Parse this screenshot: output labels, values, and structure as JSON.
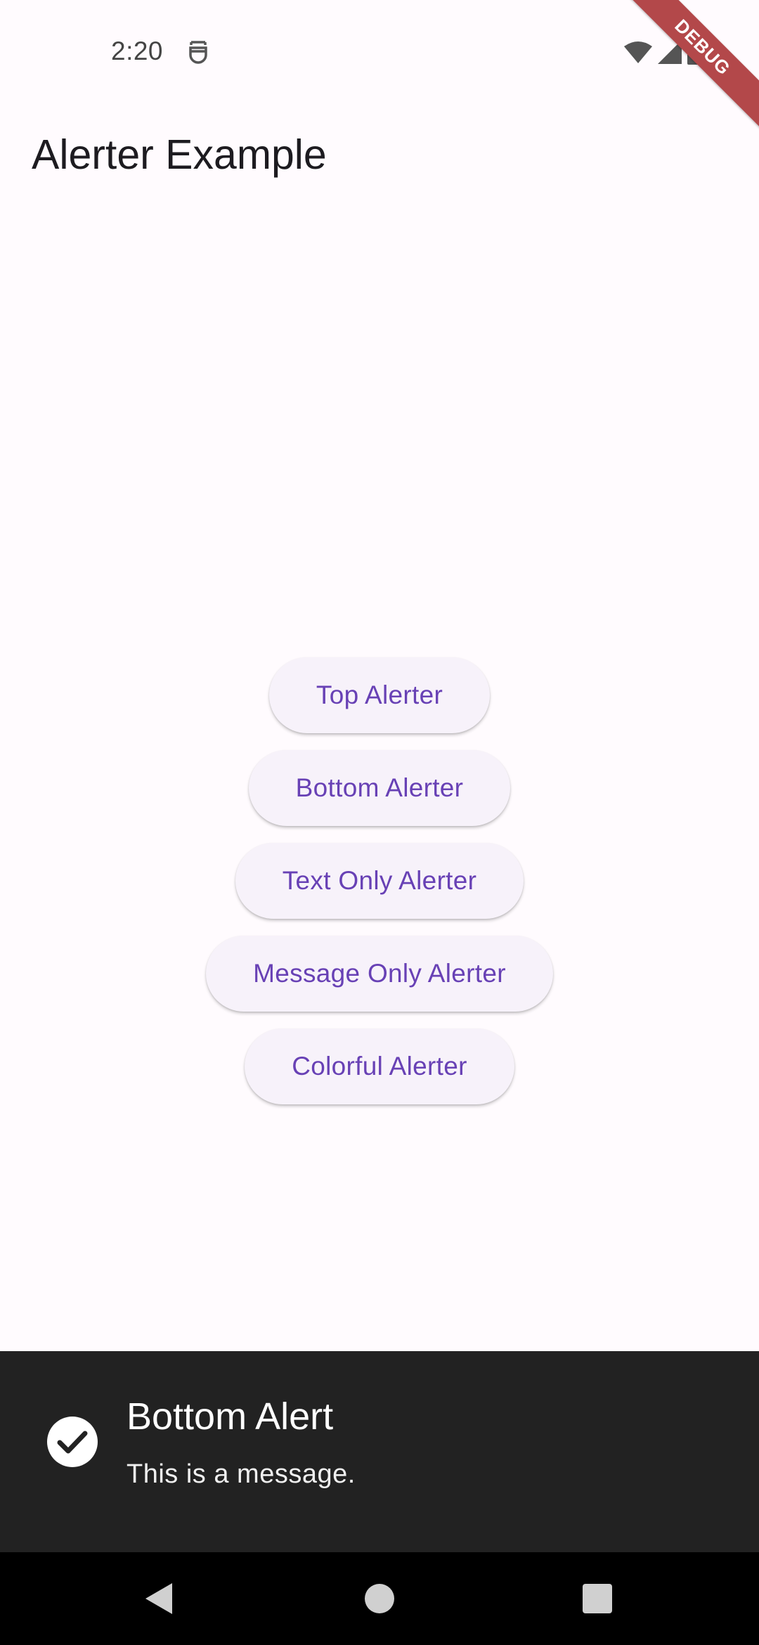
{
  "status_bar": {
    "time": "2:20",
    "icons": [
      "app-notification-icon",
      "wifi-icon",
      "signal-icon",
      "battery-icon"
    ]
  },
  "debug_banner": {
    "label": "DEBUG"
  },
  "app_bar": {
    "title": "Alerter Example"
  },
  "buttons": {
    "top": "Top Alerter",
    "bottom": "Bottom Alerter",
    "text_only": "Text Only Alerter",
    "message_only": "Message Only Alerter",
    "colorful": "Colorful Alerter"
  },
  "alert": {
    "title": "Bottom Alert",
    "message": "This is a message.",
    "icon": "check-circle-icon"
  },
  "nav_bar": {
    "icons": [
      "back-icon",
      "home-icon",
      "recents-icon"
    ]
  },
  "colors": {
    "background": "#fffbfe",
    "button_bg": "#f7f2fa",
    "button_text": "#6841b5",
    "alert_bg": "#222222",
    "debug_ribbon": "#b3484a"
  }
}
